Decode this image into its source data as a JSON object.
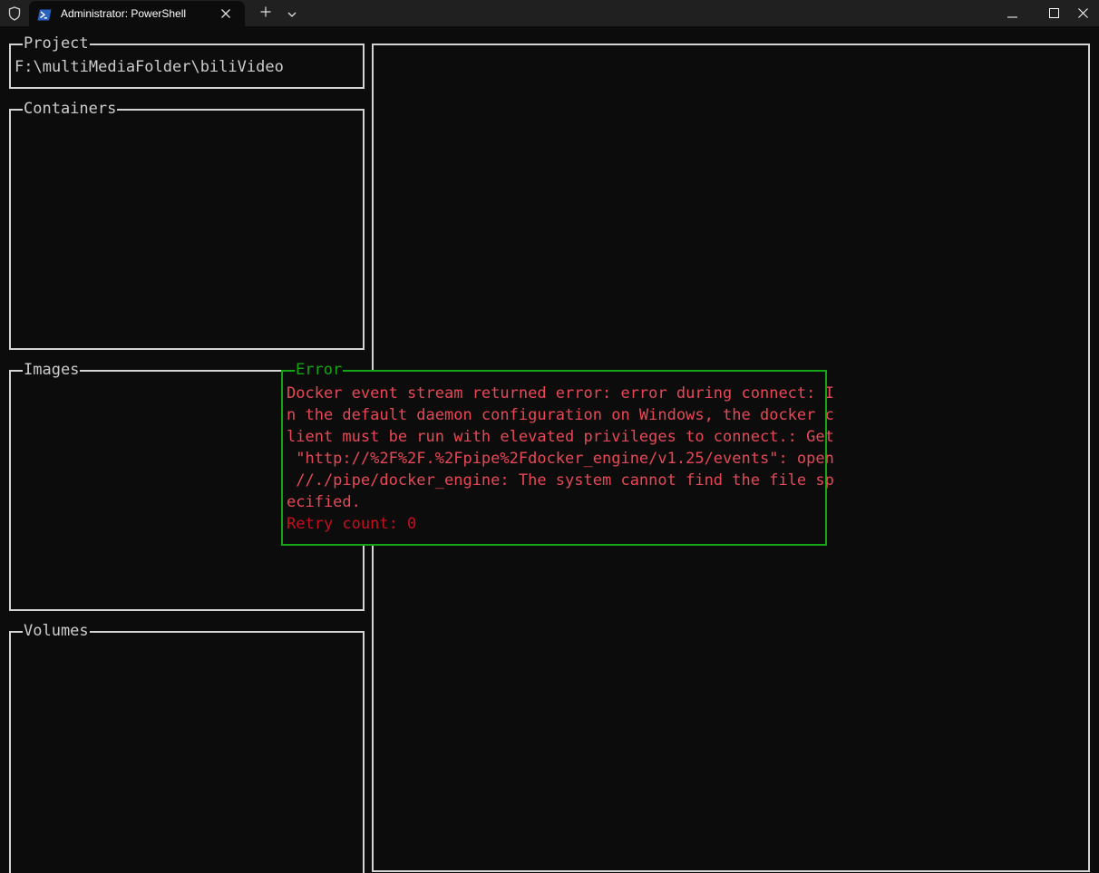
{
  "window": {
    "tab_title": "Administrator: PowerShell",
    "icons": {
      "shield": "shield-icon",
      "powershell": "powershell-icon",
      "close_tab": "close-icon",
      "new_tab": "plus-icon",
      "dropdown": "chevron-down-icon",
      "minimize": "minimize-icon",
      "maximize": "maximize-icon",
      "close_window": "close-icon"
    }
  },
  "panels": {
    "project": {
      "title": "Project",
      "value": "F:\\multiMediaFolder\\biliVideo"
    },
    "containers": {
      "title": "Containers"
    },
    "images": {
      "title": "Images"
    },
    "volumes": {
      "title": "Volumes"
    }
  },
  "error": {
    "title": "Error",
    "lines": [
      "Docker event stream returned error: error during connect: I",
      "n the default daemon configuration on Windows, the docker c",
      "lient must be run with elevated privileges to connect.: Get",
      " \"http://%2F%2F.%2Fpipe%2Fdocker_engine/v1.25/events\": open",
      " //./pipe/docker_engine: The system cannot find the file sp",
      "ecified."
    ],
    "retry": "Retry count: 0"
  },
  "colors": {
    "background": "#0c0c0c",
    "titlebar": "#202020",
    "border": "#d4d4d4",
    "error_border": "#16a316",
    "error_text": "#e74856",
    "retry_text": "#c50f1f"
  }
}
